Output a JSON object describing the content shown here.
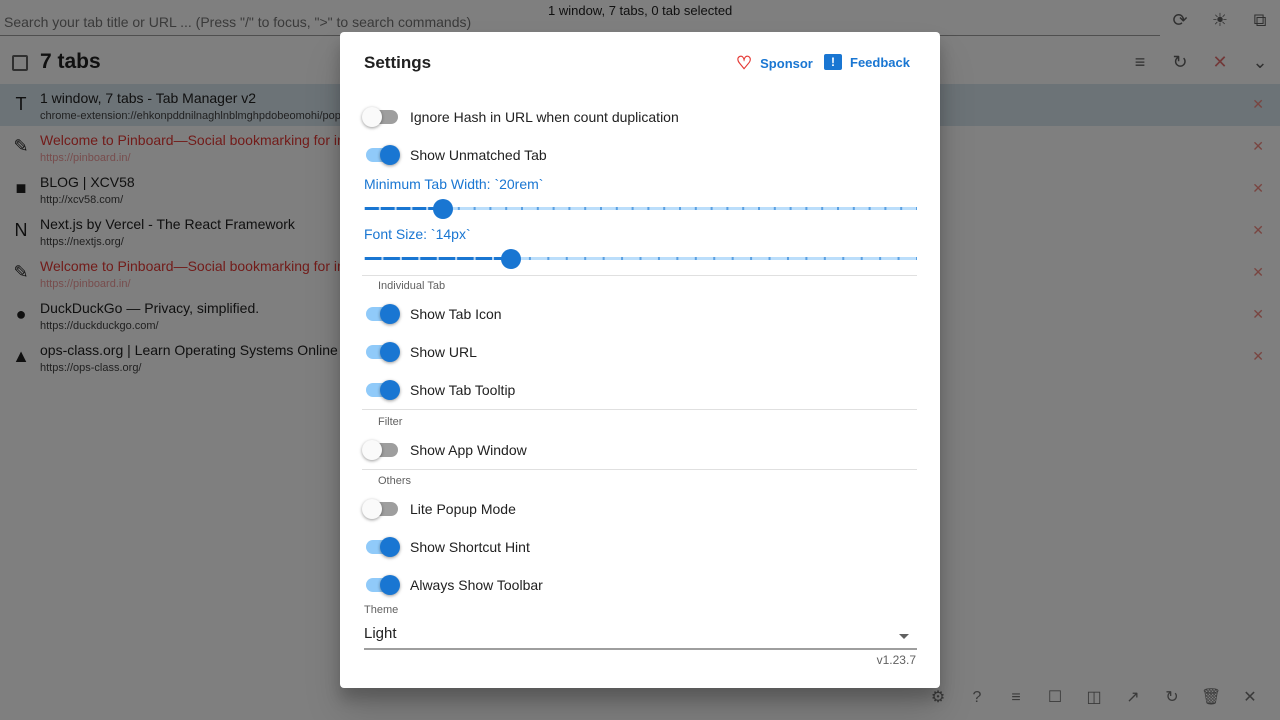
{
  "topbar": {
    "search_placeholder": "Search your tab title or URL ... (Press \"/\" to focus, \">\" to search commands)",
    "window_summary": "1 window, 7 tabs, 0 tab selected"
  },
  "tabs_header": {
    "count_label": "7 tabs"
  },
  "tabs": [
    {
      "title": "1 window, 7 tabs - Tab Manager v2",
      "url": "chrome-extension://ehkonpddnilnaghlnblmghpdobeomohi/popup.html",
      "icon": "T",
      "active": true,
      "duplicate": false
    },
    {
      "title": "Welcome to Pinboard—Social bookmarking for introverts",
      "url": "https://pinboard.in/",
      "icon": "✎",
      "active": false,
      "duplicate": true
    },
    {
      "title": "BLOG | XCV58",
      "url": "http://xcv58.com/",
      "icon": "■",
      "active": false,
      "duplicate": false
    },
    {
      "title": "Next.js by Vercel - The React Framework",
      "url": "https://nextjs.org/",
      "icon": "N",
      "active": false,
      "duplicate": false
    },
    {
      "title": "Welcome to Pinboard—Social bookmarking for introverts",
      "url": "https://pinboard.in/",
      "icon": "✎",
      "active": false,
      "duplicate": true
    },
    {
      "title": "DuckDuckGo — Privacy, simplified.",
      "url": "https://duckduckgo.com/",
      "icon": "●",
      "active": false,
      "duplicate": false
    },
    {
      "title": "ops-class.org | Learn Operating Systems Online",
      "url": "https://ops-class.org/",
      "icon": "▲",
      "active": false,
      "duplicate": false
    }
  ],
  "dialog": {
    "title": "Settings",
    "sponsor_label": "Sponsor",
    "feedback_label": "Feedback",
    "ignore_hash": {
      "label": "Ignore Hash in URL when count duplication",
      "on": false
    },
    "show_unmatched": {
      "label": "Show Unmatched Tab",
      "on": true
    },
    "min_tab_width": {
      "label": "Minimum Tab Width: `20rem`",
      "value": 20,
      "min": 15,
      "max": 50
    },
    "font_size": {
      "label": "Font Size: `14px`",
      "value": 14,
      "min": 6,
      "max": 36
    },
    "section_individual": "Individual Tab",
    "show_tab_icon": {
      "label": "Show Tab Icon",
      "on": true
    },
    "show_url": {
      "label": "Show URL",
      "on": true
    },
    "show_tab_tooltip": {
      "label": "Show Tab Tooltip",
      "on": true
    },
    "section_filter": "Filter",
    "show_app_window": {
      "label": "Show App Window",
      "on": false
    },
    "section_others": "Others",
    "lite_popup": {
      "label": "Lite Popup Mode",
      "on": false
    },
    "show_shortcut_hint": {
      "label": "Show Shortcut Hint",
      "on": true
    },
    "always_show_toolbar": {
      "label": "Always Show Toolbar",
      "on": true
    },
    "theme_label": "Theme",
    "theme_value": "Light",
    "version": "v1.23.7"
  },
  "colors": {
    "accent": "#1976d2",
    "duplicate": "#e53935",
    "overlay": "rgba(0,0,0,0.5)"
  }
}
